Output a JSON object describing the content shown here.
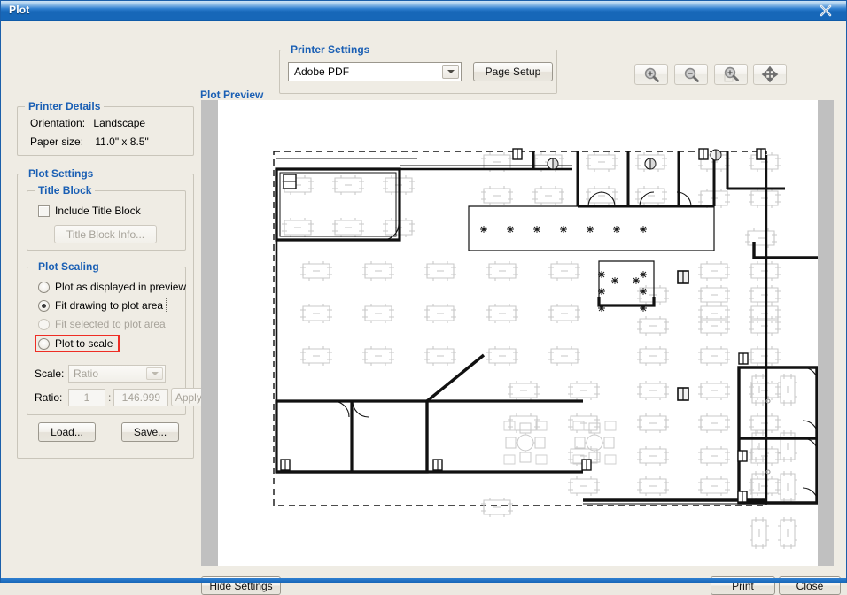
{
  "window": {
    "title": "Plot",
    "close_icon": "close-icon"
  },
  "printer_details": {
    "caption": "Printer Details",
    "orientation_label": "Orientation:",
    "orientation_value": "Landscape",
    "paper_size_label": "Paper size:",
    "paper_size_value": "11.0\" x 8.5\""
  },
  "plot_settings": {
    "caption": "Plot Settings",
    "title_block": {
      "caption": "Title Block",
      "include_label": "Include Title Block",
      "include_checked": false,
      "info_button": "Title Block Info...",
      "info_button_enabled": false
    },
    "plot_scaling": {
      "caption": "Plot Scaling",
      "options": [
        {
          "label": "Plot as displayed in preview",
          "selected": false,
          "enabled": true,
          "focused": false,
          "highlighted": false
        },
        {
          "label": "Fit drawing to plot area",
          "selected": true,
          "enabled": true,
          "focused": true,
          "highlighted": false
        },
        {
          "label": "Fit selected to plot area",
          "selected": false,
          "enabled": false,
          "focused": false,
          "highlighted": false
        },
        {
          "label": "Plot to scale",
          "selected": false,
          "enabled": true,
          "focused": false,
          "highlighted": true
        }
      ],
      "scale_label": "Scale:",
      "scale_value": "Ratio",
      "scale_enabled": false,
      "ratio_label": "Ratio:",
      "ratio_numerator": "1",
      "ratio_separator": ":",
      "ratio_denominator": "146.999",
      "apply_button": "Apply",
      "apply_enabled": false
    },
    "load_button": "Load...",
    "save_button": "Save..."
  },
  "printer_settings": {
    "caption": "Printer Settings",
    "printer_value": "Adobe PDF",
    "page_setup_button": "Page Setup"
  },
  "toolbar": {
    "buttons": [
      {
        "name": "zoom-in-icon",
        "tip": "Zoom In"
      },
      {
        "name": "zoom-out-icon",
        "tip": "Zoom Out"
      },
      {
        "name": "zoom-window-icon",
        "tip": "Zoom Window"
      },
      {
        "name": "pan-icon",
        "tip": "Pan"
      }
    ]
  },
  "plot_preview": {
    "caption": "Plot Preview"
  },
  "footer": {
    "hide_settings_button": "Hide Settings",
    "print_button": "Print",
    "close_button": "Close"
  },
  "colors": {
    "accent": "#1a5fb4",
    "titlebar": "#1767b8",
    "dialog_bg": "#efece4",
    "highlight": "#ee2d24",
    "gutter": "#c0c0c0"
  }
}
